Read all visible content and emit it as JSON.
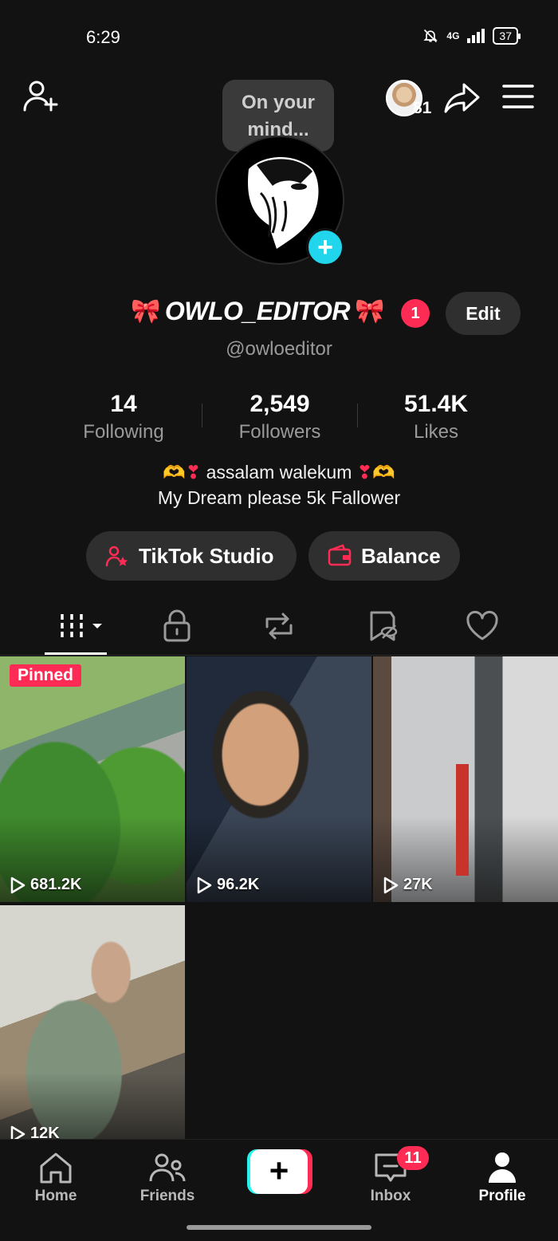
{
  "status_bar": {
    "time": "6:29",
    "network": "4G",
    "battery": "37"
  },
  "header": {
    "bubble_text": "On your mind...",
    "viewers_count": "81"
  },
  "profile": {
    "display_name": "OWLO_EDITOR",
    "bow": "🎀",
    "badge_count": "1",
    "edit_label": "Edit",
    "handle": "@owloeditor",
    "stats": [
      {
        "value": "14",
        "label": "Following"
      },
      {
        "value": "2,549",
        "label": "Followers"
      },
      {
        "value": "51.4K",
        "label": "Likes"
      }
    ],
    "bio_line1": "assalam walekum",
    "bio_emoji_hands": "🫶",
    "bio_emoji_heart": "❣",
    "bio_line2": "My Dream please 5k Fallower"
  },
  "actions": {
    "studio_label": "TikTok Studio",
    "balance_label": "Balance"
  },
  "tabs": [
    "videos",
    "private",
    "reposts",
    "favorites",
    "liked"
  ],
  "videos": [
    {
      "views": "681.2K",
      "pinned_label": "Pinned"
    },
    {
      "views": "96.2K"
    },
    {
      "views": "27K"
    },
    {
      "views": "12K"
    }
  ],
  "nav": {
    "home": "Home",
    "friends": "Friends",
    "create": "+",
    "inbox": "Inbox",
    "inbox_badge": "11",
    "profile": "Profile"
  },
  "colors": {
    "accent": "#fe2c55",
    "cyan": "#20d5ec",
    "bg": "#121212",
    "pill": "#2f2f2f"
  }
}
